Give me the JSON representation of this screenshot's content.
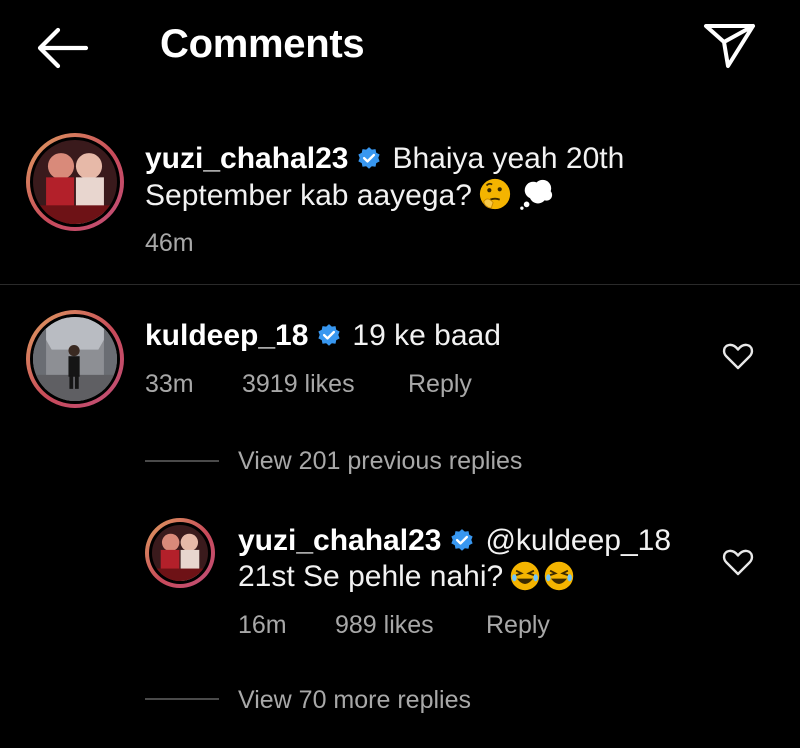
{
  "header": {
    "title": "Comments",
    "back_icon": "arrow-left-icon",
    "send_icon": "paper-plane-icon"
  },
  "caption": {
    "username": "yuzi_chahal23",
    "text_line1": "Bhaiya yeah 20th",
    "text_line2": "September kab aayega?",
    "emojis": [
      "thinking-face-emoji",
      "thought-balloon-emoji"
    ],
    "time": "46m",
    "verified": true
  },
  "comment": {
    "username": "kuldeep_18",
    "text": "19 ke baad",
    "time": "33m",
    "likes": "3919 likes",
    "reply_label": "Reply",
    "verified": true
  },
  "view_previous": {
    "label": "View 201 previous replies"
  },
  "reply": {
    "username": "yuzi_chahal23",
    "mention": "@kuldeep_18",
    "text_line2": "21st Se pehle nahi?",
    "emojis": [
      "rolling-on-floor-laughing-emoji",
      "rolling-on-floor-laughing-emoji"
    ],
    "time": "16m",
    "likes": "989 likes",
    "reply_label": "Reply",
    "verified": true
  },
  "view_more": {
    "label": "View 70 more replies"
  },
  "colors": {
    "background": "#000000",
    "text": "#f5f5f5",
    "muted": "#a8a8a8",
    "verified_blue": "#3897f0",
    "story_ring": "#d2566a"
  }
}
